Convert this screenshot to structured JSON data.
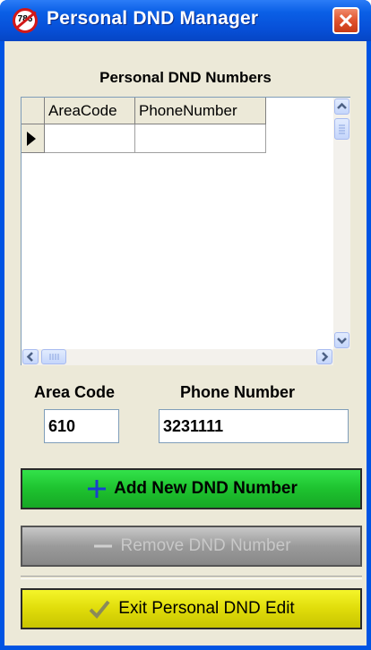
{
  "window": {
    "title": "Personal DND Manager",
    "icon_text": "786",
    "close_glyph": "✕"
  },
  "section_title": "Personal DND Numbers",
  "grid": {
    "columns": [
      "AreaCode",
      "PhoneNumber"
    ],
    "rows": [
      [
        "",
        ""
      ]
    ]
  },
  "form": {
    "area_code_label": "Area Code",
    "area_code_value": "610",
    "phone_label": "Phone Number",
    "phone_value": "3231111"
  },
  "buttons": {
    "add_label": "Add New DND Number",
    "remove_label": "Remove DND Number",
    "exit_label": "Exit Personal DND Edit",
    "add_icon": "plus-icon",
    "remove_icon": "minus-icon",
    "exit_icon": "checkmark-icon"
  },
  "colors": {
    "titlebar": "#0a5fe6",
    "add_button": "#1ec22f",
    "remove_button": "#9a9a9a",
    "exit_button": "#e0dc0a",
    "close_button": "#e0532e"
  }
}
